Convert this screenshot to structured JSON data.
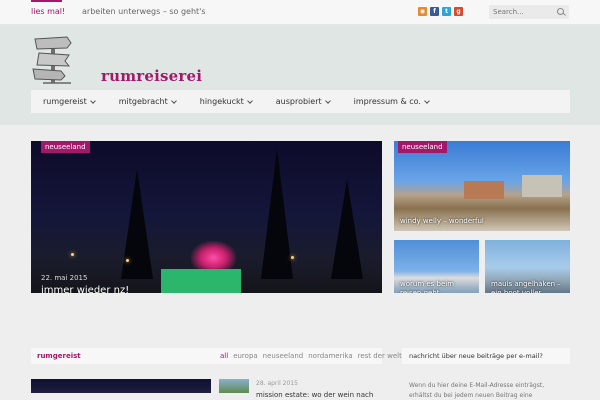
{
  "topbar": {
    "lies_label": "lies mal!",
    "ticker": "arbeiten unterwegs – so geht's",
    "social": [
      "rss-icon",
      "facebook-icon",
      "twitter-icon",
      "google-plus-icon"
    ],
    "search_placeholder": "Search..."
  },
  "header": {
    "logo_text": "rumreiserei",
    "nav": [
      "rumgereist",
      "mitgebracht",
      "hingekuckt",
      "ausprobiert",
      "impressum & co."
    ]
  },
  "featured": {
    "big": {
      "category": "neuseeland",
      "date": "22. mai 2015",
      "title": "immer wieder nz!"
    },
    "top": {
      "category": "neuseeland",
      "title": "windy welly – wonderful"
    },
    "small": [
      {
        "title": "worum es beim reisen geht"
      },
      {
        "title": "mauis angelhaken – ein boot voller legenden"
      }
    ]
  },
  "section": {
    "title": "rumgereist",
    "filters": [
      "all",
      "europa",
      "neuseeland",
      "nordamerika",
      "rest der welt"
    ],
    "post_date": "28. april 2015",
    "post_title": "mission estate: wo der wein nach"
  },
  "widget": {
    "title": "nachricht über neue beiträge per e-mail?",
    "text": "Wenn du hier deine E-Mail-Adresse einträgst, erhältst du bei jedem neuen Beitrag eine"
  },
  "colors": {
    "accent": "#a2186a",
    "header_bg": "#dfe6e3"
  }
}
